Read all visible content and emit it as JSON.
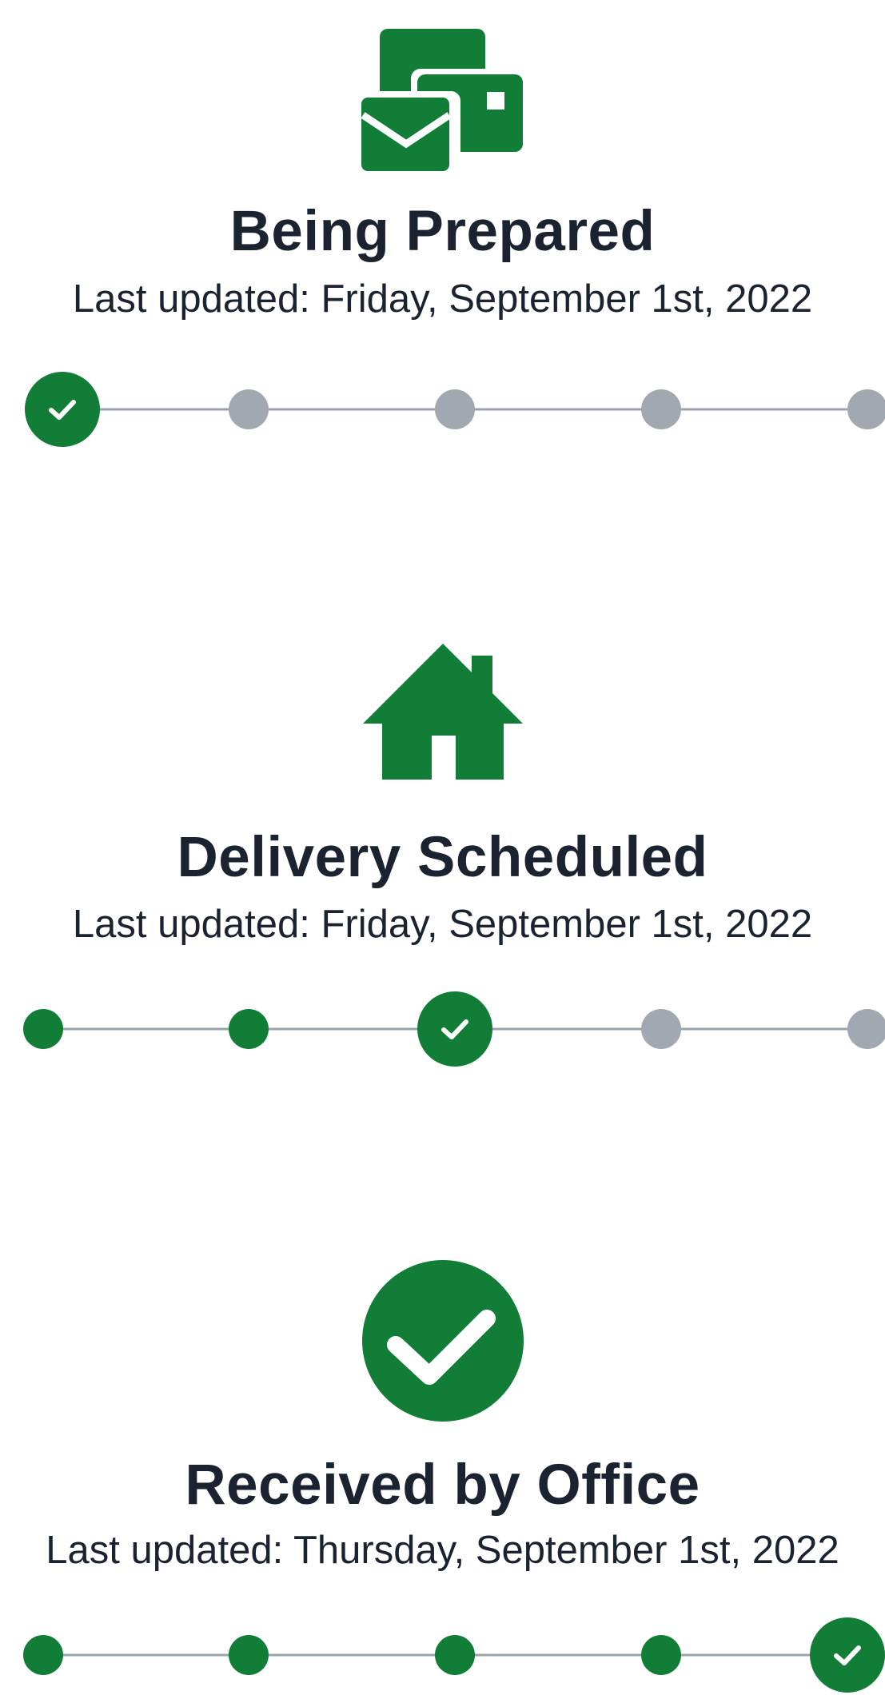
{
  "colors": {
    "accent": "#117d37",
    "inactive": "#a1a8b2",
    "line": "#9aa3ad",
    "text": "#1b2331"
  },
  "steps": [
    {
      "icon": "mail-packages-icon",
      "title": "Being Prepared",
      "updated": "Last updated: Friday, September 1st, 2022",
      "current_step": 1
    },
    {
      "icon": "house-icon",
      "title": "Delivery Scheduled",
      "updated": "Last updated: Friday, September 1st, 2022",
      "current_step": 3
    },
    {
      "icon": "check-circle-icon",
      "title": "Received by Office",
      "updated": "Last updated: Thursday, September 1st, 2022",
      "current_step": 5
    }
  ],
  "tracker_step_count": 5
}
